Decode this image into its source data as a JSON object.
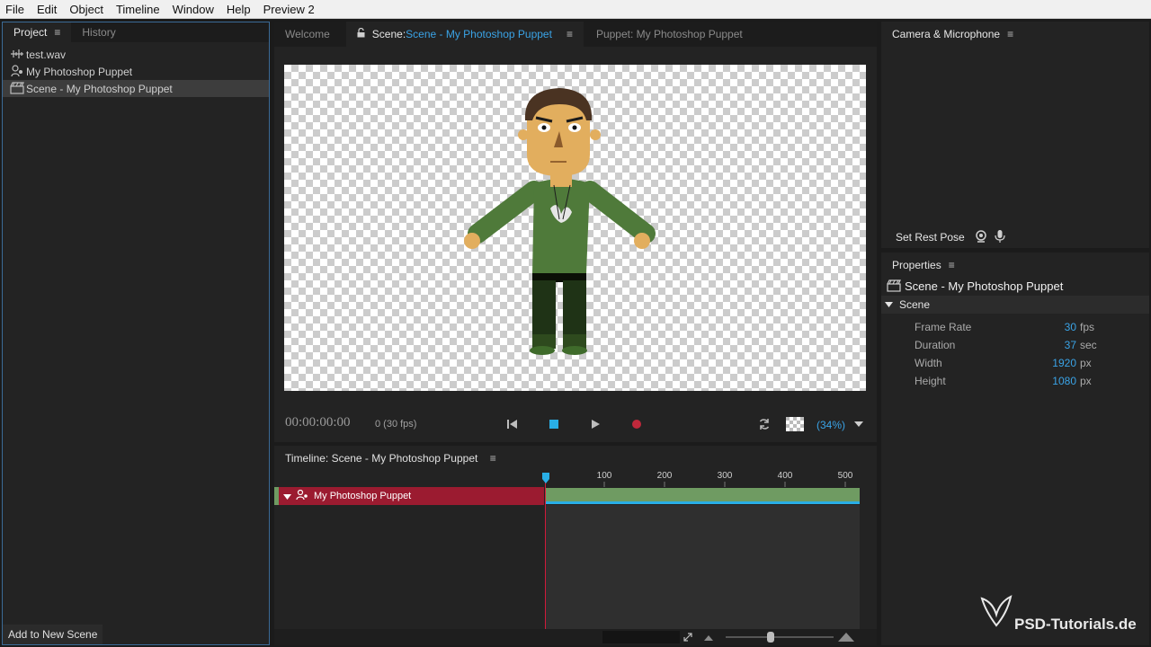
{
  "menu": [
    "File",
    "Edit",
    "Object",
    "Timeline",
    "Window",
    "Help",
    "Preview 2"
  ],
  "project_panel": {
    "tabs": [
      "Project",
      "History"
    ],
    "items": [
      {
        "label": "test.wav",
        "icon": "audio-icon"
      },
      {
        "label": "My Photoshop Puppet",
        "icon": "puppet-icon"
      },
      {
        "label": "Scene - My Photoshop Puppet",
        "icon": "scene-icon",
        "selected": true
      }
    ],
    "add_button": "Add to New Scene"
  },
  "scene_panel": {
    "tabs": {
      "welcome": "Welcome",
      "scene_prefix": "Scene:",
      "scene_name": "Scene - My Photoshop Puppet",
      "puppet": "Puppet: My Photoshop Puppet"
    },
    "transport": {
      "timecode": "00:00:00:00",
      "frame": "0 (30 fps)",
      "zoom": "(34%)"
    }
  },
  "timeline_panel": {
    "title": "Timeline: Scene - My Photoshop Puppet",
    "ruler_ticks": [
      "100",
      "200",
      "300",
      "400",
      "500"
    ],
    "track": "My Photoshop Puppet"
  },
  "camera_panel": {
    "title": "Camera & Microphone",
    "rest_pose": "Set Rest Pose"
  },
  "properties_panel": {
    "title": "Properties",
    "object": "Scene - My Photoshop Puppet",
    "section": "Scene",
    "rows": [
      {
        "key": "Frame Rate",
        "value": "30",
        "unit": "fps"
      },
      {
        "key": "Duration",
        "value": "37",
        "unit": "sec"
      },
      {
        "key": "Width",
        "value": "1920",
        "unit": "px"
      },
      {
        "key": "Height",
        "value": "1080",
        "unit": "px"
      }
    ]
  },
  "watermark": "PSD-Tutorials.de",
  "colors": {
    "accent": "#3aa3e6",
    "track": "#9b1b30",
    "clip": "#6f9b62",
    "record": "#c0283b"
  }
}
